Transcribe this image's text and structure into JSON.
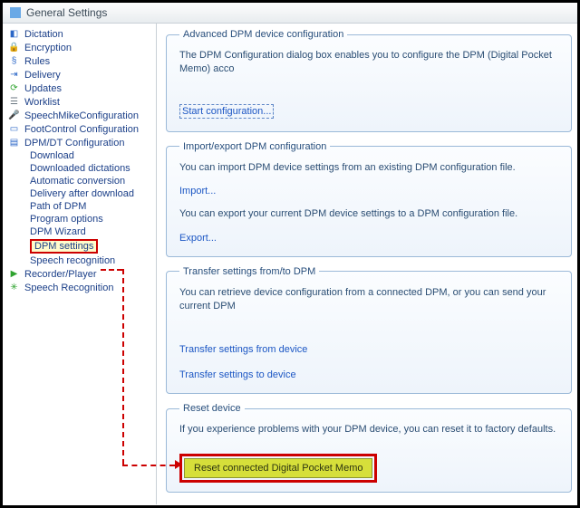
{
  "window": {
    "title": "General Settings"
  },
  "sidebar": {
    "items": [
      {
        "label": "Dictation"
      },
      {
        "label": "Encryption"
      },
      {
        "label": "Rules"
      },
      {
        "label": "Delivery"
      },
      {
        "label": "Updates"
      },
      {
        "label": "Worklist"
      },
      {
        "label": "SpeechMikeConfiguration"
      },
      {
        "label": "FootControl Configuration"
      },
      {
        "label": "DPM/DT Configuration"
      },
      {
        "label": "Recorder/Player"
      },
      {
        "label": "Speech Recognition"
      }
    ],
    "dpm_children": [
      {
        "label": "Download"
      },
      {
        "label": "Downloaded dictations"
      },
      {
        "label": "Automatic conversion"
      },
      {
        "label": "Delivery after download"
      },
      {
        "label": "Path of DPM"
      },
      {
        "label": "Program options"
      },
      {
        "label": "DPM Wizard"
      },
      {
        "label": "DPM settings"
      },
      {
        "label": "Speech recognition"
      }
    ]
  },
  "panels": {
    "advanced": {
      "legend": "Advanced DPM device configuration",
      "text": "The DPM Configuration dialog box enables you to configure the DPM (Digital Pocket Memo) acco",
      "link": "Start configuration..."
    },
    "importexport": {
      "legend": "Import/export DPM configuration",
      "text1": "You can import DPM device settings from an existing DPM configuration file.",
      "link1": "Import...",
      "text2": "You can export your current DPM device settings to a DPM configuration file.",
      "link2": "Export..."
    },
    "transfer": {
      "legend": "Transfer settings from/to DPM",
      "text": "You can retrieve device configuration from a connected DPM, or you can send your current DPM",
      "link1": "Transfer settings from device",
      "link2": "Transfer settings to device"
    },
    "reset": {
      "legend": "Reset device",
      "text": "If you experience problems with your DPM device, you can reset it to factory defaults.",
      "button": "Reset connected Digital Pocket Memo"
    }
  }
}
